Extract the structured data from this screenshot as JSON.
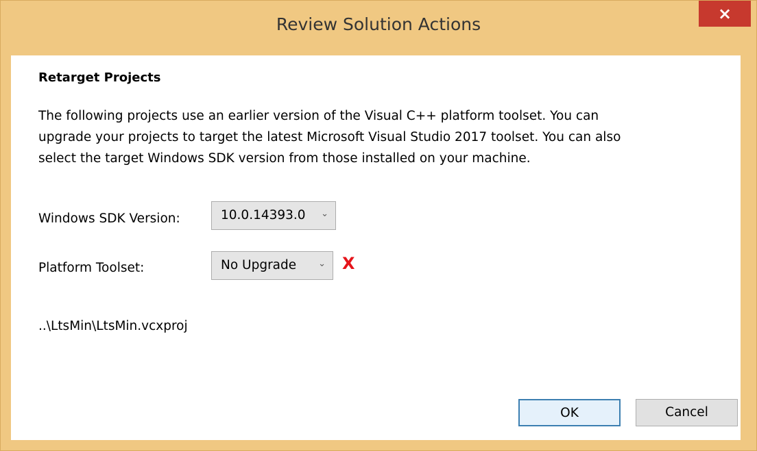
{
  "window": {
    "title": "Review Solution Actions",
    "close_glyph": "×"
  },
  "content": {
    "heading": "Retarget Projects",
    "description_lines": [
      "The following projects use an earlier version of the Visual C++ platform toolset.  You can",
      "upgrade your projects to target the latest Microsoft Visual Studio 2017 toolset.  You can also",
      "select the target Windows SDK version from those installed on your machine."
    ],
    "sdk": {
      "label": "Windows SDK Version:",
      "value": "10.0.14393.0",
      "chevron_icon": "chevron-down-icon",
      "chevron_glyph": "⌄"
    },
    "toolset": {
      "label": "Platform Toolset:",
      "value": "No Upgrade",
      "chevron_glyph": "⌄",
      "annotation_mark": "X",
      "annotation_color": "#e5141b"
    },
    "project_path": "..\\LtsMin\\LtsMin.vcxproj"
  },
  "buttons": {
    "ok_label": "OK",
    "cancel_label": "Cancel"
  },
  "colors": {
    "window_frame": "#f0c882",
    "close_button": "#c7392e",
    "ok_border": "#3c7fb1"
  }
}
